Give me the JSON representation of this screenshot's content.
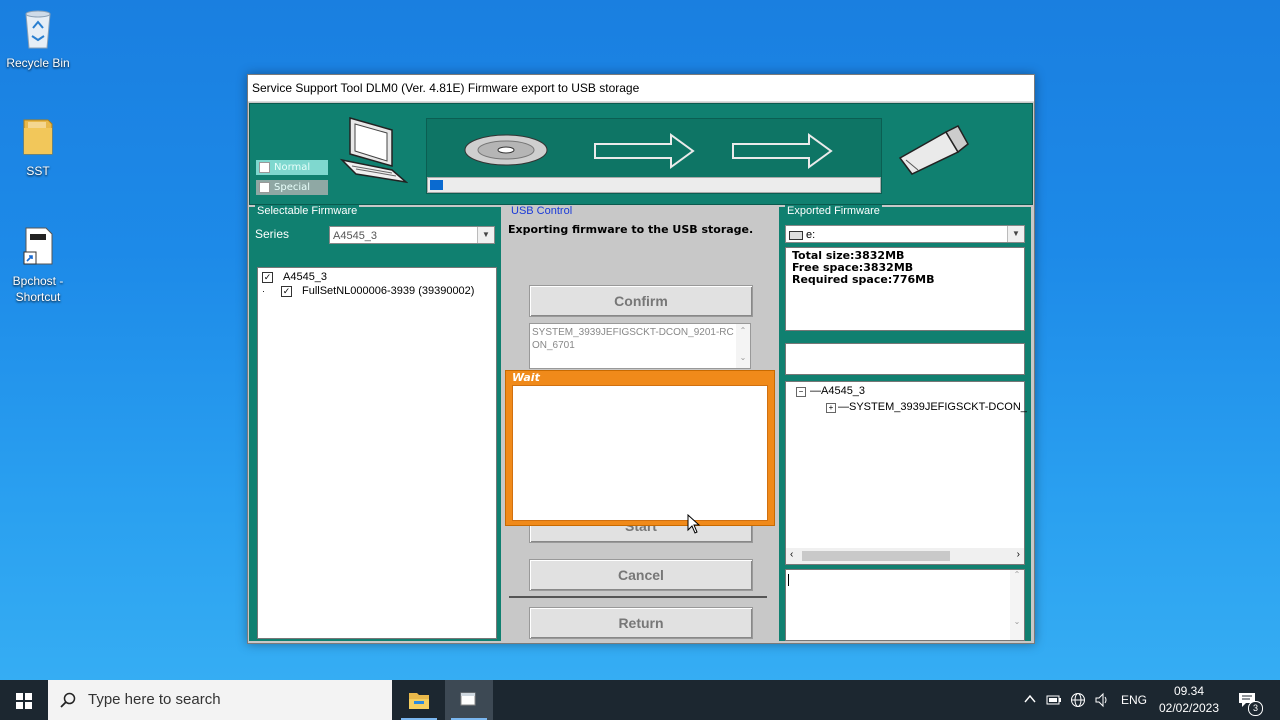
{
  "desktop": {
    "icons": [
      {
        "label": "Recycle Bin"
      },
      {
        "label": "SST"
      },
      {
        "label": "Bpchost - Shortcut"
      }
    ]
  },
  "window": {
    "title": "Service Support Tool DLM0 (Ver. 4.81E) Firmware export to USB storage",
    "mode": {
      "normal_label": "Normal",
      "special_label": "Special"
    },
    "progress_fraction": 0.03,
    "selectable": {
      "label": "Selectable Firmware",
      "series_label": "Series",
      "series_value": "A4545_3",
      "tree": [
        {
          "label": "A4545_3",
          "checked": true
        },
        {
          "label": "FullSetNL000006-3939 (39390002)",
          "checked": true
        }
      ]
    },
    "usb": {
      "label": "USB Control",
      "status": "Exporting firmware to the USB storage.",
      "confirm_label": "Confirm",
      "list_text": "SYSTEM_3939JEFIGSCKT-DCON_9201-RCON_6701",
      "wait_label": "Wait",
      "start_label": "Start",
      "cancel_label": "Cancel",
      "return_label": "Return"
    },
    "exported": {
      "label": "Exported Firmware",
      "drive": "e:",
      "total": "Total size:3832MB",
      "free": "Free space:3832MB",
      "required": "Required space:776MB",
      "tree": [
        {
          "label": "A4545_3"
        },
        {
          "label": "SYSTEM_3939JEFIGSCKT-DCON_"
        }
      ]
    }
  },
  "taskbar": {
    "search_placeholder": "Type here to search",
    "lang": "ENG",
    "time": "09.34",
    "date": "02/02/2023",
    "notifications": "3"
  },
  "colors": {
    "panel": "#108070",
    "wait": "#f08a1a",
    "taskbar": "#1c2730"
  }
}
